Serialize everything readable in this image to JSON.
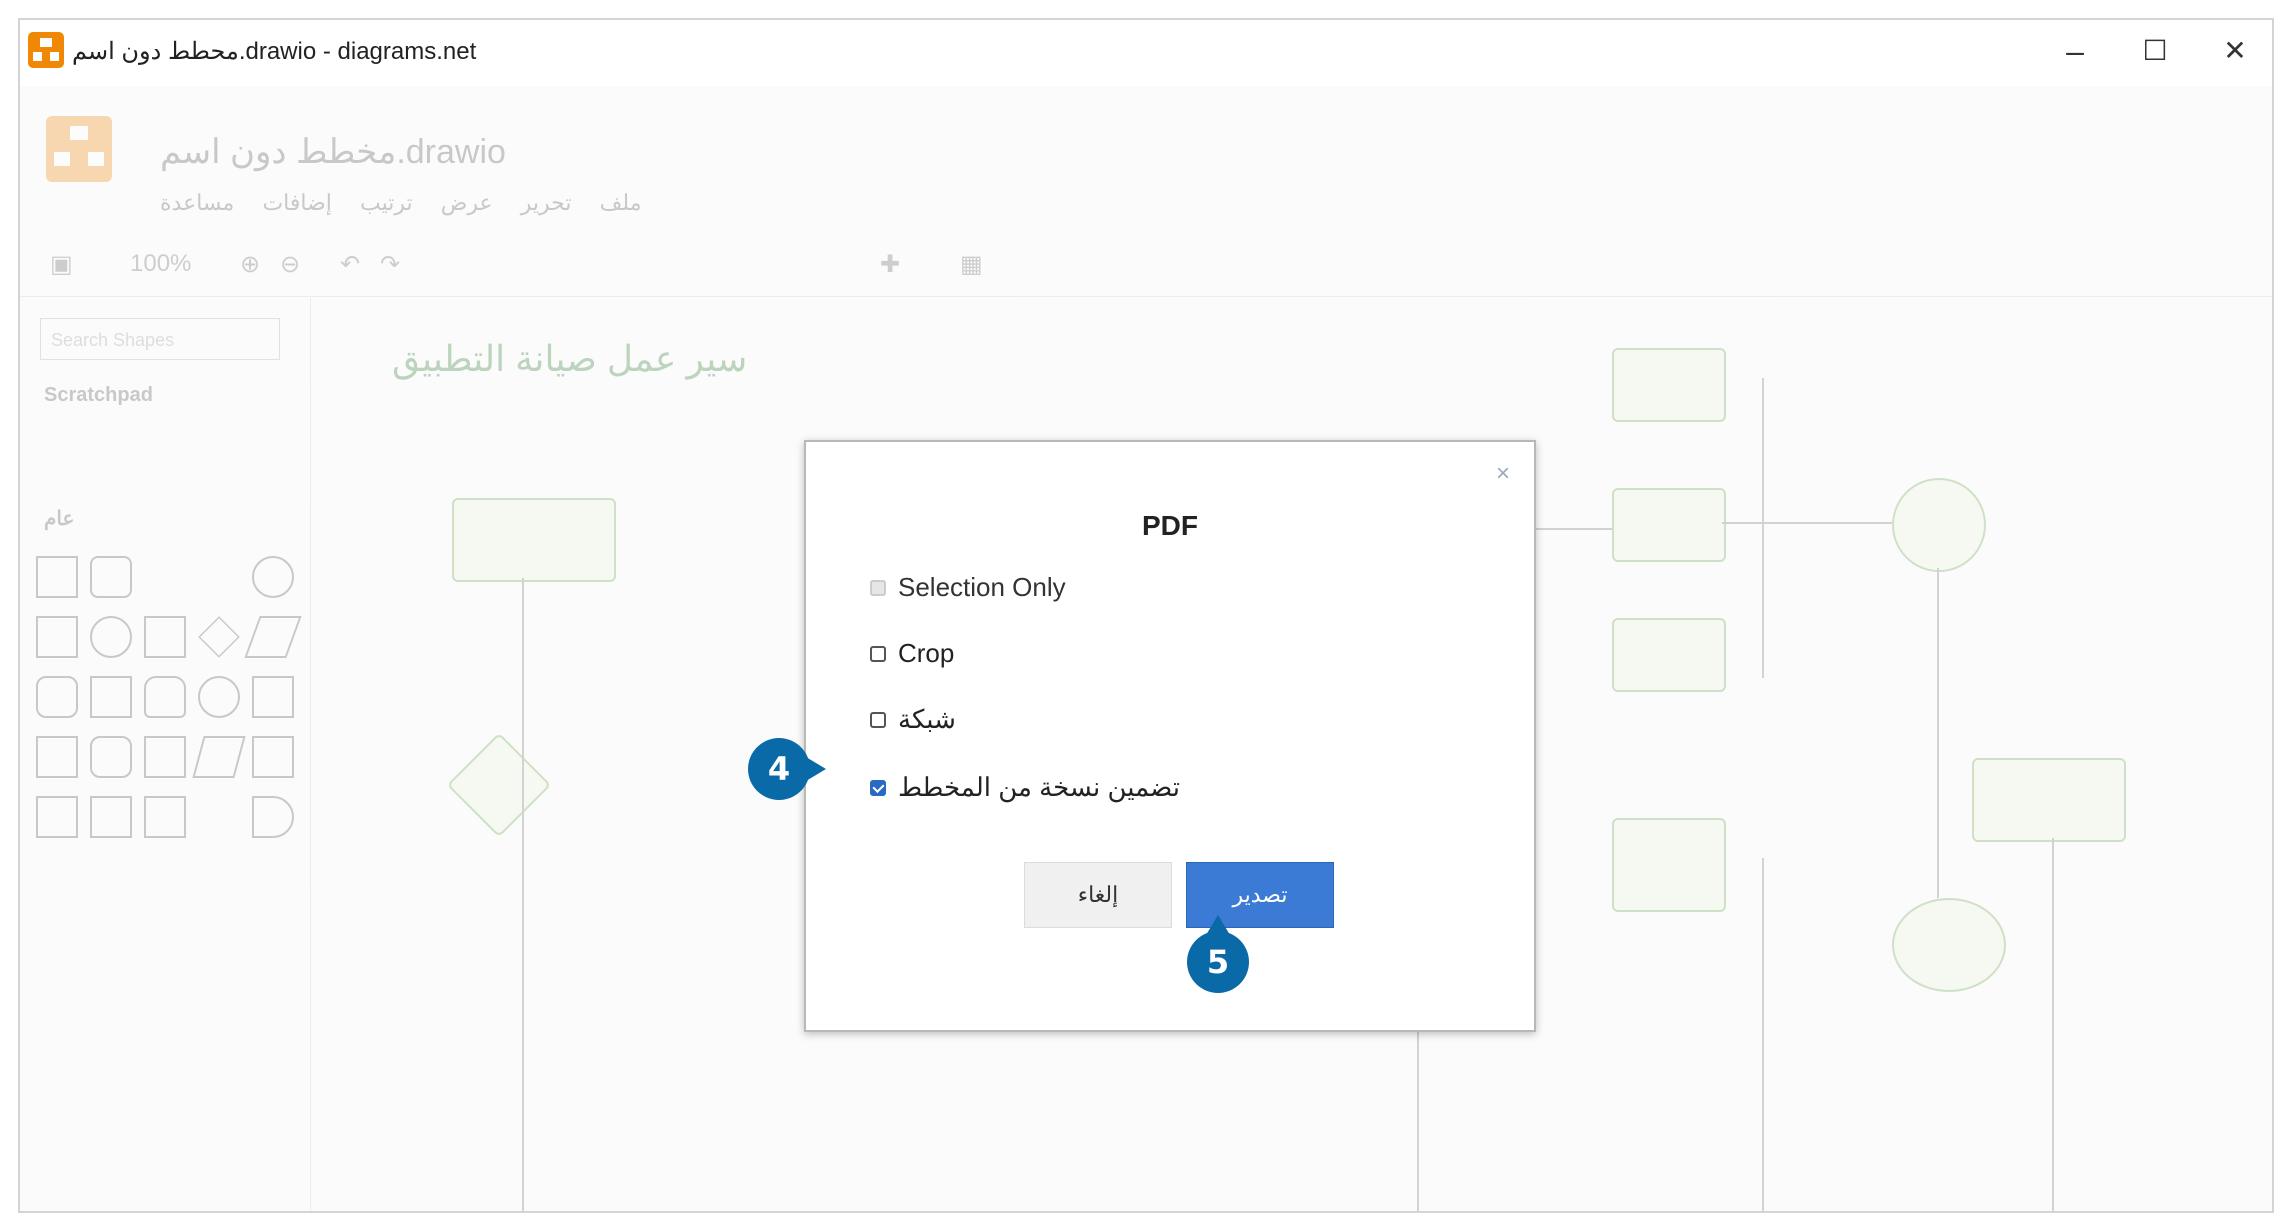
{
  "window": {
    "title": "محطط دون اسم.drawio - diagrams.net",
    "controls": {
      "minimize": "–",
      "maximize": "☐",
      "close": "✕"
    }
  },
  "app": {
    "doc_title": "مخطط دون اسم.drawio",
    "menu": [
      "ملف",
      "تحرير",
      "عرض",
      "ترتيب",
      "إضافات",
      "مساعدة"
    ],
    "toolbar": {
      "zoom": "100%"
    },
    "sidebar": {
      "search_placeholder": "Search Shapes",
      "section_scratchpad": "Scratchpad",
      "section_general": "عام"
    },
    "canvas_title": "سير عمل صيانة التطبيق"
  },
  "dialog": {
    "title": "PDF",
    "close_icon": "×",
    "options": [
      {
        "label": "Selection Only",
        "state": "disabled"
      },
      {
        "label": "Crop",
        "state": "unchecked"
      },
      {
        "label": "شبكة",
        "state": "unchecked"
      },
      {
        "label": "تضمين نسخة من المخطط",
        "state": "checked"
      }
    ],
    "buttons": {
      "cancel": "إلغاء",
      "export": "تصدير"
    }
  },
  "callouts": {
    "step4": "4",
    "step5": "5"
  },
  "colors": {
    "accent": "#0a6aa8",
    "export_button": "#3b7bd5",
    "drawio_orange": "#f08705"
  }
}
